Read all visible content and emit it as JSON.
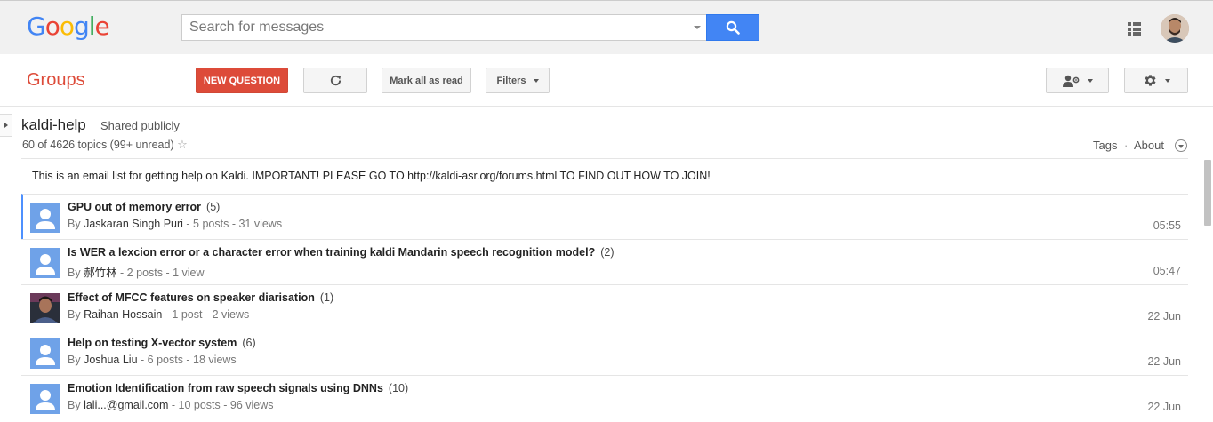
{
  "header": {
    "logo": "Google",
    "search_placeholder": "Search for messages",
    "colors": {
      "logo_blue": "#4285f4",
      "logo_red": "#ea4335",
      "logo_yellow": "#fbbc05",
      "logo_green": "#34a853",
      "search_button": "#4285f4"
    }
  },
  "toolbar": {
    "section_title": "Groups",
    "new_question": "NEW QUESTION",
    "mark_all_read": "Mark all as read",
    "filters": "Filters",
    "accent": "#dd4b39"
  },
  "group": {
    "name": "kaldi-help",
    "visibility": "Shared publicly",
    "topic_count": "60 of 4626 topics (99+ unread)",
    "tags": "Tags",
    "separator": "·",
    "about": "About",
    "description": "This is an email list for getting help on Kaldi. IMPORTANT! PLEASE GO TO http://kaldi-asr.org/forums.html TO FIND OUT HOW TO JOIN!"
  },
  "topics": [
    {
      "subject": "GPU out of memory error",
      "count": "(5)",
      "author": "Jaskaran Singh Puri",
      "stats": " - 5 posts - 31 views",
      "time": "05:55",
      "selected": true,
      "avatar": "default"
    },
    {
      "subject": "Is WER a lexcion error or a character error when training kaldi Mandarin speech recognition model?",
      "count": "(2)",
      "author": "郝竹林",
      "stats": " - 2 posts - 1 view",
      "time": "05:47",
      "selected": false,
      "avatar": "default"
    },
    {
      "subject": "Effect of MFCC features on speaker diarisation",
      "count": "(1)",
      "author": "Raihan Hossain",
      "stats": " - 1 post - 2 views",
      "time": "22 Jun",
      "selected": false,
      "avatar": "photo"
    },
    {
      "subject": "Help on testing X-vector system",
      "count": "(6)",
      "author": "Joshua Liu",
      "stats": " - 6 posts - 18 views",
      "time": "22 Jun",
      "selected": false,
      "avatar": "default"
    },
    {
      "subject": "Emotion Identification from raw speech signals using DNNs",
      "count": "(10)",
      "author": "lali...@gmail.com",
      "stats": " - 10 posts - 96 views",
      "time": "22 Jun",
      "selected": false,
      "avatar": "default"
    }
  ]
}
